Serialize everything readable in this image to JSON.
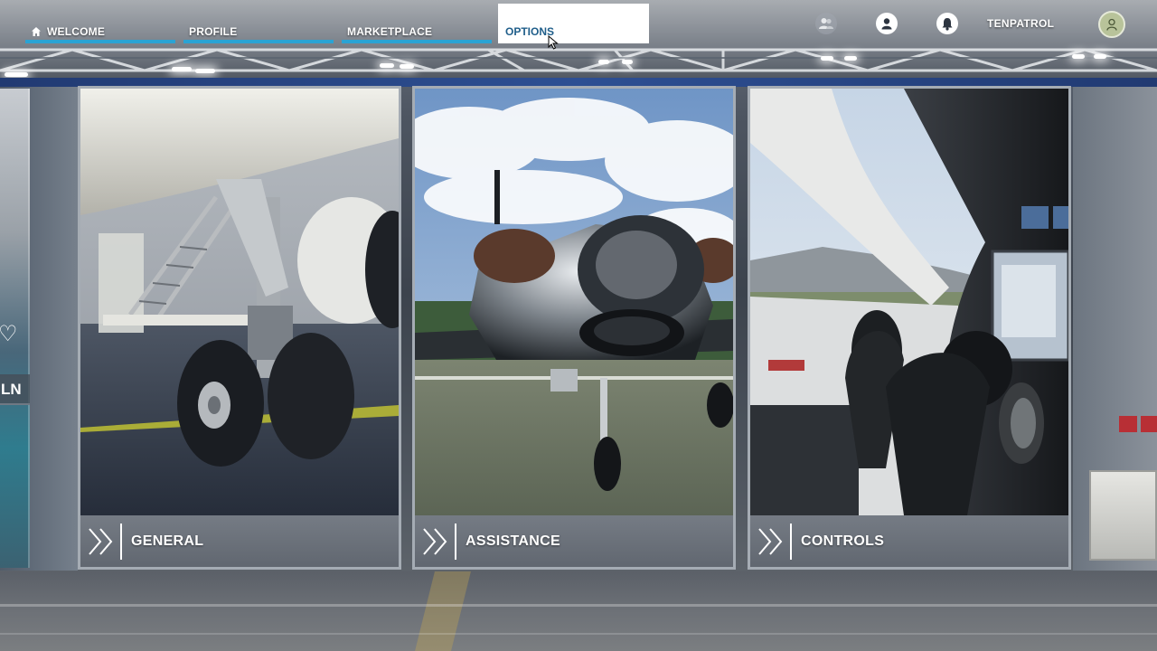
{
  "nav": {
    "tabs": [
      {
        "label": "WELCOME",
        "icon": "home-icon",
        "active": false
      },
      {
        "label": "PROFILE",
        "active": false
      },
      {
        "label": "MARKETPLACE",
        "active": false
      },
      {
        "label": "OPTIONS",
        "active": true
      }
    ],
    "accent_color": "#2aa3d4"
  },
  "user": {
    "username": "TENPATROL",
    "icons": [
      "friends-icon",
      "account-icon",
      "notifications-icon",
      "avatar"
    ]
  },
  "previous_card": {
    "label": "LN",
    "icon": "heart-icon"
  },
  "cards": [
    {
      "label": "GENERAL",
      "icon": "chevron-double-icon"
    },
    {
      "label": "ASSISTANCE",
      "icon": "chevron-double-icon"
    },
    {
      "label": "CONTROLS",
      "icon": "chevron-double-icon"
    }
  ]
}
